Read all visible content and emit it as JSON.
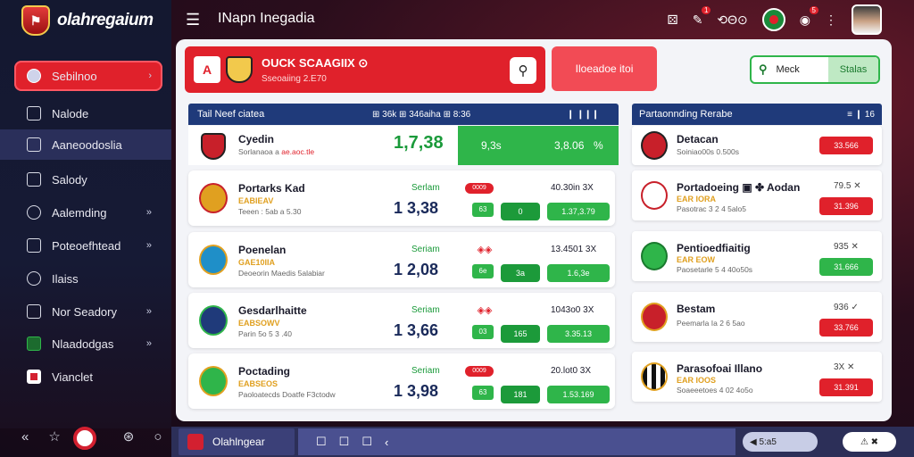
{
  "app": {
    "logo_text": "olahregaium",
    "logo_badge": "⚑"
  },
  "topbar": {
    "title": "INapn Inegadia",
    "icons": [
      "dice-icon",
      "bet-slip-icon",
      "settings-icon",
      "flag-icon",
      "notifications-icon",
      "more-icon",
      "avatar"
    ],
    "badge1": "1",
    "badge2": "5",
    "text_icon": "⟲Θ⊙"
  },
  "sidebar": {
    "items": [
      {
        "label": "Sebilnoo",
        "chev": "›"
      },
      {
        "label": "Nalode",
        "chev": ""
      },
      {
        "label": "Aaneoodoslia",
        "chev": ""
      },
      {
        "label": "Salody",
        "chev": ""
      },
      {
        "label": "Aalemding",
        "chev": "»"
      },
      {
        "label": "Poteoefhtead",
        "chev": "»"
      },
      {
        "label": "Ilaiss",
        "chev": ""
      },
      {
        "label": "Nor Seadory",
        "chev": "»"
      },
      {
        "label": "Nlaadodgas",
        "chev": "»"
      },
      {
        "label": "Vianclet",
        "chev": ""
      }
    ]
  },
  "banner": {
    "flag": "A",
    "title": "OUCK SCAAGIIX ⊙",
    "subtitle": "Sseoaiing 2.E70",
    "cta": "Iloeadoe itoi",
    "search_value": "Meck",
    "search_button": "Stalas"
  },
  "left_list": {
    "header": "Tail Neef ciatea",
    "header_right": "⊞ 36k  ⊞ 346aiha  ⊞ 8:36",
    "header_far": "❙ ❙❙❙",
    "first": {
      "name": "Cyedin",
      "sub": "Sorlanaoa a",
      "sub_red": "ae.aoc.tle",
      "odds": "1,7,38",
      "g1": "9,3s",
      "g2": "3,8.06",
      "g3": "%"
    },
    "matches": [
      {
        "name": "Portarks Kad",
        "sub1": "EABIEAV",
        "sub2": "Teeen : 5ab a 5.30",
        "mid": "Serlam",
        "big": "1  3,38",
        "tag": "0009",
        "right": "40.30in  3X",
        "p1": "63",
        "p2": "0",
        "p3": "1.37,3.79"
      },
      {
        "name": "Poenelan",
        "sub1": "GAE10IIA",
        "sub2": "Deoeorin Maedis 5alabiar",
        "mid": "Seriam",
        "big": "1  2,08",
        "tag": "◈◈",
        "right": "13.4501  3X",
        "p1": "6e",
        "p2": "3a",
        "p3": "1.6,3e"
      },
      {
        "name": "Gesdarlhaitte",
        "sub1": "EABSOWV",
        "sub2": "Parin 5o 5 3 .40",
        "mid": "Seriam",
        "big": "1  3,66",
        "tag": "◈◈",
        "right": "1043o0 3X",
        "p1": "03",
        "p2": "165",
        "p3": "3.35.13"
      },
      {
        "name": "Poctading",
        "sub1": "EABSEOS",
        "sub2": "Paoloatecds Doatfe F3ctodw",
        "mid": "Seriam",
        "big": "1  3,98",
        "tag": "0009",
        "right": "20.lot0  3X",
        "p1": "63",
        "p2": "181",
        "p3": "1.53.169"
      }
    ]
  },
  "right_list": {
    "header": "Partaonnding Rerabe",
    "header_right": "≡  ❙ 16",
    "items": [
      {
        "name": "Detacan",
        "sub1": "",
        "sub2": "Soiniao00s 0.500s",
        "mid": "",
        "pill": "33.566",
        "pill_color": "red"
      },
      {
        "name": "Portadoeing ▣ ✤ Aodan",
        "sub1": "EAR IORA",
        "sub2": "Pasotrac 3 2 4 5alo5",
        "mid": "79.5  ✕",
        "pill": "31.396",
        "pill_color": "red"
      },
      {
        "name": "Pentioedfiaitig",
        "sub1": "EAR EOW",
        "sub2": "Paosetarle 5 4 40o50s",
        "mid": "935  ✕",
        "pill": "31.666",
        "pill_color": "green"
      },
      {
        "name": "Bestam",
        "sub1": "",
        "sub2": "Peemarla Ia 2 6 5ao",
        "mid": "936  ✓",
        "pill": "33.766",
        "pill_color": "red"
      },
      {
        "name": "Parasofoai Illano",
        "sub1": "EAR IOOS",
        "sub2": "Soaeeetoes 4 02 4o5o",
        "mid": "3X  ✕",
        "pill": "31.391",
        "pill_color": "red"
      }
    ]
  },
  "bottombar": {
    "app_label": "Olahlngear",
    "tools": [
      "☐",
      "☐",
      "☐",
      "‹"
    ],
    "right1": "◀  5:a5",
    "right2": "⚠  ✖"
  },
  "colors": {
    "accent_red": "#e0212b",
    "accent_green": "#2fb54a",
    "navy": "#1f3a7a"
  }
}
